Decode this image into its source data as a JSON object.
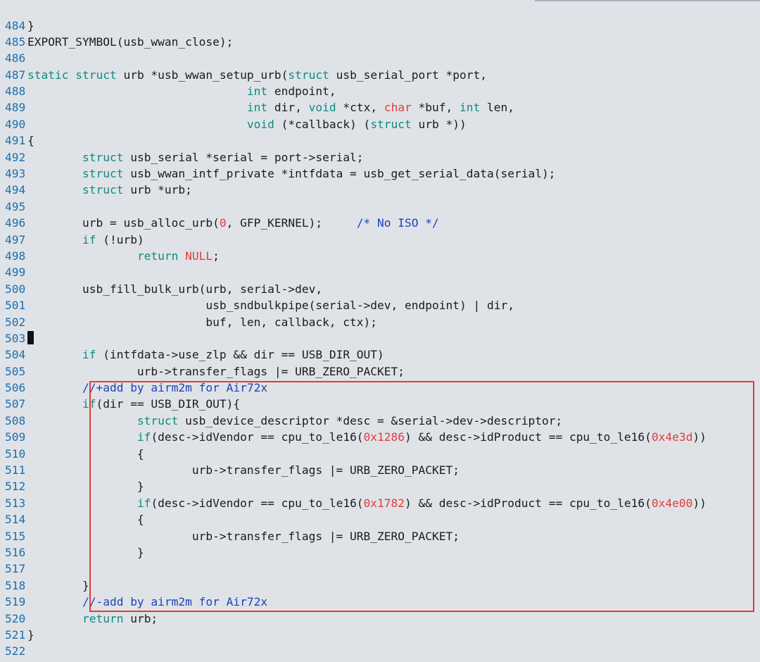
{
  "lines": [
    {
      "n": "484",
      "segs": [
        {
          "t": "}",
          "c": "plain"
        }
      ]
    },
    {
      "n": "485",
      "segs": [
        {
          "t": "EXPORT_SYMBOL(usb_wwan_close);",
          "c": "plain"
        }
      ]
    },
    {
      "n": "486",
      "segs": []
    },
    {
      "n": "487",
      "segs": [
        {
          "t": "static struct",
          "c": "kw"
        },
        {
          "t": " urb *usb_wwan_setup_urb(",
          "c": "plain"
        },
        {
          "t": "struct",
          "c": "kw"
        },
        {
          "t": " usb_serial_port *port,",
          "c": "plain"
        }
      ]
    },
    {
      "n": "488",
      "segs": [
        {
          "t": "                                ",
          "c": "plain"
        },
        {
          "t": "int",
          "c": "kw"
        },
        {
          "t": " endpoint,",
          "c": "plain"
        }
      ]
    },
    {
      "n": "489",
      "segs": [
        {
          "t": "                                ",
          "c": "plain"
        },
        {
          "t": "int",
          "c": "kw"
        },
        {
          "t": " dir, ",
          "c": "plain"
        },
        {
          "t": "void",
          "c": "kw"
        },
        {
          "t": " *ctx, ",
          "c": "plain"
        },
        {
          "t": "char",
          "c": "red"
        },
        {
          "t": " *buf, ",
          "c": "plain"
        },
        {
          "t": "int",
          "c": "kw"
        },
        {
          "t": " len,",
          "c": "plain"
        }
      ]
    },
    {
      "n": "490",
      "segs": [
        {
          "t": "                                ",
          "c": "plain"
        },
        {
          "t": "void",
          "c": "kw"
        },
        {
          "t": " (*callback) (",
          "c": "plain"
        },
        {
          "t": "struct",
          "c": "kw"
        },
        {
          "t": " urb *))",
          "c": "plain"
        }
      ]
    },
    {
      "n": "491",
      "segs": [
        {
          "t": "{",
          "c": "plain"
        }
      ]
    },
    {
      "n": "492",
      "segs": [
        {
          "t": "        ",
          "c": "plain"
        },
        {
          "t": "struct",
          "c": "kw"
        },
        {
          "t": " usb_serial *serial = port->serial;",
          "c": "plain"
        }
      ]
    },
    {
      "n": "493",
      "segs": [
        {
          "t": "        ",
          "c": "plain"
        },
        {
          "t": "struct",
          "c": "kw"
        },
        {
          "t": " usb_wwan_intf_private *intfdata = usb_get_serial_data(serial);",
          "c": "plain"
        }
      ]
    },
    {
      "n": "494",
      "segs": [
        {
          "t": "        ",
          "c": "plain"
        },
        {
          "t": "struct",
          "c": "kw"
        },
        {
          "t": " urb *urb;",
          "c": "plain"
        }
      ]
    },
    {
      "n": "495",
      "segs": []
    },
    {
      "n": "496",
      "segs": [
        {
          "t": "        urb = usb_alloc_urb(",
          "c": "plain"
        },
        {
          "t": "0",
          "c": "red"
        },
        {
          "t": ", GFP_KERNEL);     ",
          "c": "plain"
        },
        {
          "t": "/* No ISO */",
          "c": "cmt"
        }
      ]
    },
    {
      "n": "497",
      "segs": [
        {
          "t": "        ",
          "c": "plain"
        },
        {
          "t": "if",
          "c": "kw"
        },
        {
          "t": " (!urb)",
          "c": "plain"
        }
      ]
    },
    {
      "n": "498",
      "segs": [
        {
          "t": "                ",
          "c": "plain"
        },
        {
          "t": "return",
          "c": "kw"
        },
        {
          "t": " ",
          "c": "plain"
        },
        {
          "t": "NULL",
          "c": "nul"
        },
        {
          "t": ";",
          "c": "plain"
        }
      ]
    },
    {
      "n": "499",
      "segs": []
    },
    {
      "n": "500",
      "segs": [
        {
          "t": "        usb_fill_bulk_urb(urb, serial->dev,",
          "c": "plain"
        }
      ]
    },
    {
      "n": "501",
      "segs": [
        {
          "t": "                          usb_sndbulkpipe(serial->dev, endpoint) | dir,",
          "c": "plain"
        }
      ]
    },
    {
      "n": "502",
      "segs": [
        {
          "t": "                          buf, len, callback, ctx);",
          "c": "plain"
        }
      ]
    },
    {
      "n": "503",
      "segs": [
        {
          "t": "",
          "c": "cursor"
        }
      ]
    },
    {
      "n": "504",
      "segs": [
        {
          "t": "        ",
          "c": "plain"
        },
        {
          "t": "if",
          "c": "kw"
        },
        {
          "t": " (intfdata->use_zlp && dir == USB_DIR_OUT)",
          "c": "plain"
        }
      ]
    },
    {
      "n": "505",
      "segs": [
        {
          "t": "                urb->transfer_flags |= URB_ZERO_PACKET;",
          "c": "plain"
        }
      ]
    },
    {
      "n": "506",
      "segs": [
        {
          "t": "        ",
          "c": "plain"
        },
        {
          "t": "//+add by airm2m for Air72x",
          "c": "cmt"
        }
      ]
    },
    {
      "n": "507",
      "segs": [
        {
          "t": "        ",
          "c": "plain"
        },
        {
          "t": "if",
          "c": "kw"
        },
        {
          "t": "(dir == USB_DIR_OUT){",
          "c": "plain"
        }
      ]
    },
    {
      "n": "508",
      "segs": [
        {
          "t": "                ",
          "c": "plain"
        },
        {
          "t": "struct",
          "c": "kw"
        },
        {
          "t": " usb_device_descriptor *desc = &serial->dev->descriptor;",
          "c": "plain"
        }
      ]
    },
    {
      "n": "509",
      "segs": [
        {
          "t": "                ",
          "c": "plain"
        },
        {
          "t": "if",
          "c": "kw"
        },
        {
          "t": "(desc->idVendor == cpu_to_le16(",
          "c": "plain"
        },
        {
          "t": "0x1286",
          "c": "red"
        },
        {
          "t": ") && desc->idProduct == cpu_to_le16(",
          "c": "plain"
        },
        {
          "t": "0x4e3d",
          "c": "red"
        },
        {
          "t": "))",
          "c": "plain"
        }
      ]
    },
    {
      "n": "510",
      "segs": [
        {
          "t": "                {",
          "c": "plain"
        }
      ]
    },
    {
      "n": "511",
      "segs": [
        {
          "t": "                        urb->transfer_flags |= URB_ZERO_PACKET;",
          "c": "plain"
        }
      ]
    },
    {
      "n": "512",
      "segs": [
        {
          "t": "                }",
          "c": "plain"
        }
      ]
    },
    {
      "n": "513",
      "segs": [
        {
          "t": "                ",
          "c": "plain"
        },
        {
          "t": "if",
          "c": "kw"
        },
        {
          "t": "(desc->idVendor == cpu_to_le16(",
          "c": "plain"
        },
        {
          "t": "0x1782",
          "c": "red"
        },
        {
          "t": ") && desc->idProduct == cpu_to_le16(",
          "c": "plain"
        },
        {
          "t": "0x4e00",
          "c": "red"
        },
        {
          "t": "))",
          "c": "plain"
        }
      ]
    },
    {
      "n": "514",
      "segs": [
        {
          "t": "                {",
          "c": "plain"
        }
      ]
    },
    {
      "n": "515",
      "segs": [
        {
          "t": "                        urb->transfer_flags |= URB_ZERO_PACKET;",
          "c": "plain"
        }
      ]
    },
    {
      "n": "516",
      "segs": [
        {
          "t": "                }",
          "c": "plain"
        }
      ]
    },
    {
      "n": "517",
      "segs": []
    },
    {
      "n": "518",
      "segs": [
        {
          "t": "        }",
          "c": "plain"
        }
      ]
    },
    {
      "n": "519",
      "segs": [
        {
          "t": "        ",
          "c": "plain"
        },
        {
          "t": "//-add by airm2m for Air72x",
          "c": "cmt"
        }
      ]
    },
    {
      "n": "520",
      "segs": [
        {
          "t": "        ",
          "c": "plain"
        },
        {
          "t": "return",
          "c": "kw"
        },
        {
          "t": " urb;",
          "c": "plain"
        }
      ]
    },
    {
      "n": "521",
      "segs": [
        {
          "t": "}",
          "c": "plain"
        }
      ]
    },
    {
      "n": "522",
      "segs": []
    }
  ]
}
